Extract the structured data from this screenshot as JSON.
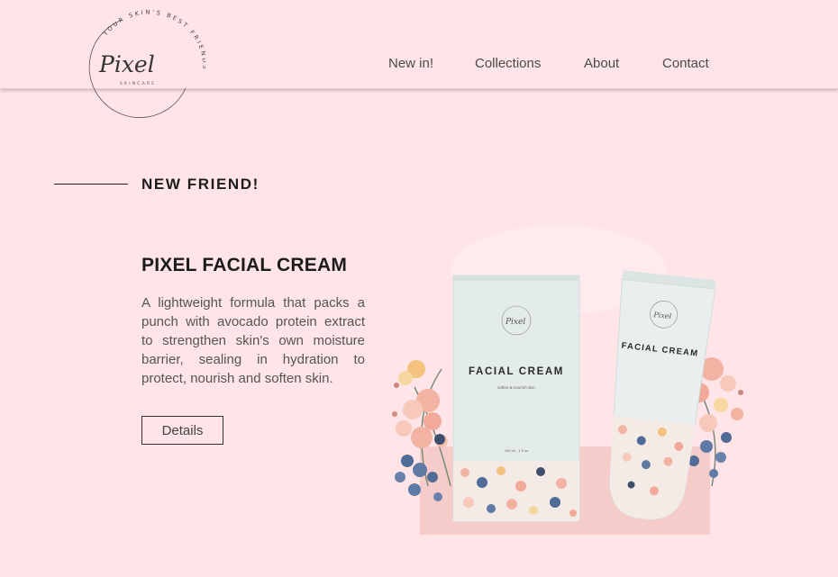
{
  "header": {
    "logo": {
      "script": "Pixel",
      "sub": "SKINCARE",
      "tagline": "YOUR SKIN'S BEST FRIENDS"
    },
    "nav": [
      {
        "label": "New in!"
      },
      {
        "label": "Collections"
      },
      {
        "label": "About"
      },
      {
        "label": "Contact"
      }
    ]
  },
  "section": {
    "title": "NEW FRIEND!"
  },
  "product": {
    "title": "PIXEL FACIAL CREAM",
    "description": "A lightweight formula that packs a punch with avocado protein extract to strengthen skin's own moisture barrier, sealing in hydration to protect, nourish and soften skin.",
    "details_label": "Details",
    "box": {
      "label": "FACIAL CREAM",
      "sub": "soften & nourish skin",
      "volume": "150 ml - 1 fl oz"
    },
    "tube": {
      "label": "FACIAL CREAM"
    }
  },
  "colors": {
    "background": "#ffe4e8",
    "text_dark": "#1d1d1d",
    "packaging": "#e4eceb",
    "flower_pink": "#f3b3a2",
    "flower_blue": "#4f6b96"
  }
}
